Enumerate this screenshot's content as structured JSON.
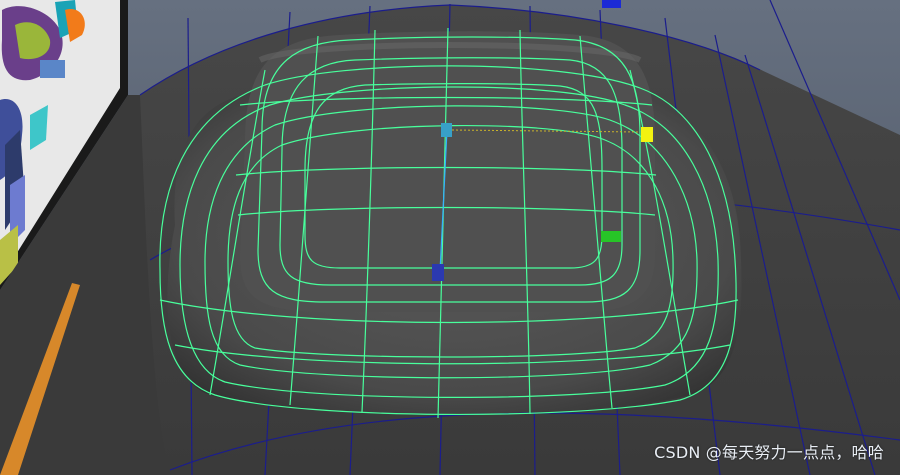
{
  "app": {
    "type": "3D modeling viewport"
  },
  "viewport": {
    "background_color": "#5b6470",
    "surface_color": "#454545",
    "mesh_wire_color": "#48ff9c",
    "ground_wire_color": "#1d1f8f"
  },
  "gizmo_handles": [
    {
      "name": "center-handle",
      "color": "#38a0c8"
    },
    {
      "name": "bottom-handle",
      "color": "#2b39b0"
    },
    {
      "name": "right-handle",
      "color": "#f2f211"
    },
    {
      "name": "side-handle",
      "color": "#27c427"
    },
    {
      "name": "top-handle",
      "color": "#1b2ad6"
    }
  ],
  "watermark": {
    "text": "CSDN @每天努力一点点，哈哈"
  }
}
